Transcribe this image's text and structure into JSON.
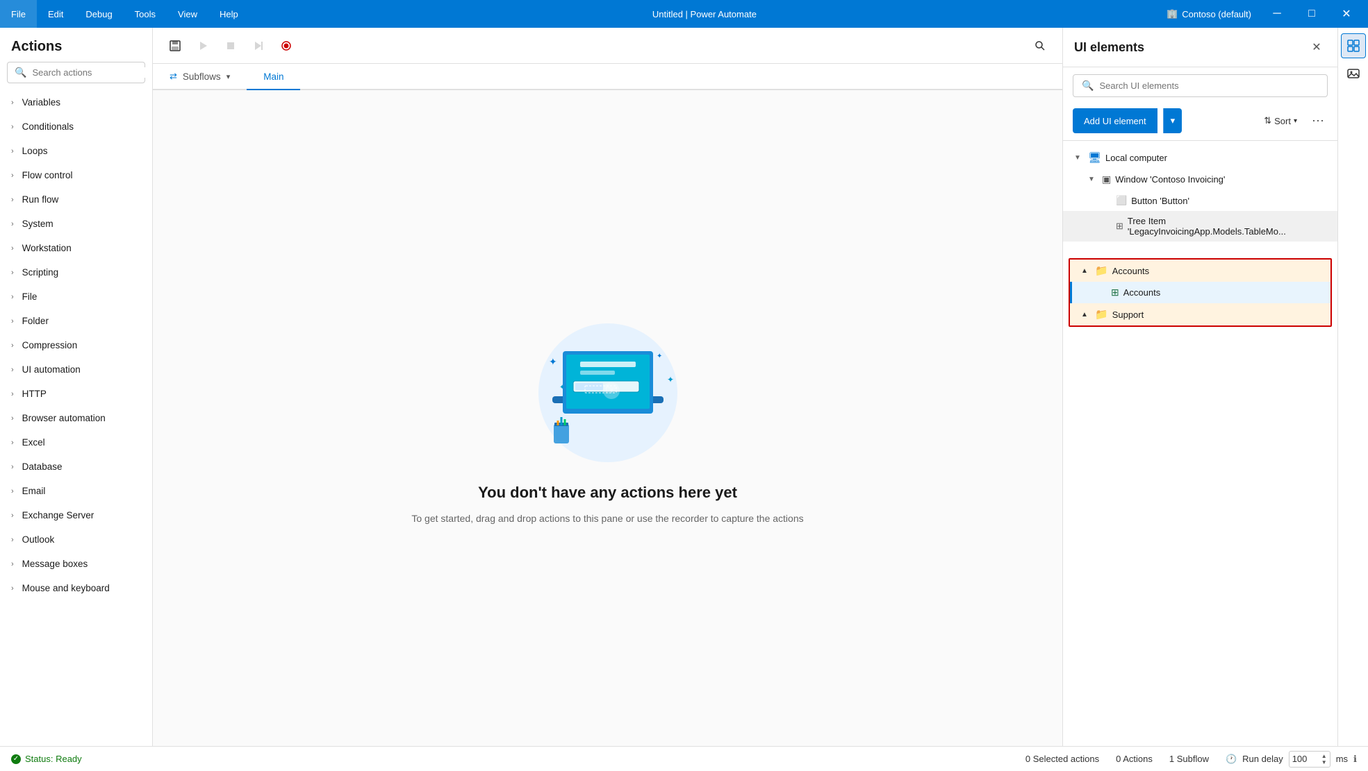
{
  "titlebar": {
    "menu_items": [
      "File",
      "Edit",
      "Debug",
      "Tools",
      "View",
      "Help"
    ],
    "title": "Untitled | Power Automate",
    "user": "Contoso (default)",
    "minimize": "─",
    "maximize": "□",
    "close": "✕"
  },
  "actions_panel": {
    "title": "Actions",
    "search_placeholder": "Search actions",
    "items": [
      "Variables",
      "Conditionals",
      "Loops",
      "Flow control",
      "Run flow",
      "System",
      "Workstation",
      "Scripting",
      "File",
      "Folder",
      "Compression",
      "UI automation",
      "HTTP",
      "Browser automation",
      "Excel",
      "Database",
      "Email",
      "Exchange Server",
      "Outlook",
      "Message boxes",
      "Mouse and keyboard"
    ]
  },
  "flow_panel": {
    "subflows_label": "Subflows",
    "main_label": "Main",
    "empty_title": "You don't have any actions here yet",
    "empty_subtitle": "To get started, drag and drop actions to this pane\nor use the recorder to capture the actions"
  },
  "ui_elements_panel": {
    "title": "UI elements",
    "search_placeholder": "Search UI elements",
    "add_button": "Add UI element",
    "sort_button": "Sort",
    "tree": [
      {
        "level": 1,
        "icon": "computer",
        "label": "Local computer",
        "expanded": true
      },
      {
        "level": 2,
        "icon": "window",
        "label": "Window 'Contoso Invoicing'",
        "expanded": true
      },
      {
        "level": 3,
        "icon": "button",
        "label": "Button 'Button'"
      },
      {
        "level": 3,
        "icon": "treeitem",
        "label": "Tree Item 'LegacyInvoicingApp.Models.TableMo..."
      }
    ],
    "bottom_section": [
      {
        "level": 1,
        "icon": "folder",
        "label": "Accounts",
        "expanded": true
      },
      {
        "level": 2,
        "icon": "table",
        "label": "Accounts",
        "selected": true
      },
      {
        "level": 1,
        "icon": "folder",
        "label": "Support",
        "expanded": true
      }
    ]
  },
  "status_bar": {
    "status_text": "Status: Ready",
    "selected_actions": "0 Selected actions",
    "actions_count": "0 Actions",
    "subflow_count": "1 Subflow",
    "run_delay_label": "Run delay",
    "run_delay_value": "100",
    "ms_label": "ms"
  }
}
